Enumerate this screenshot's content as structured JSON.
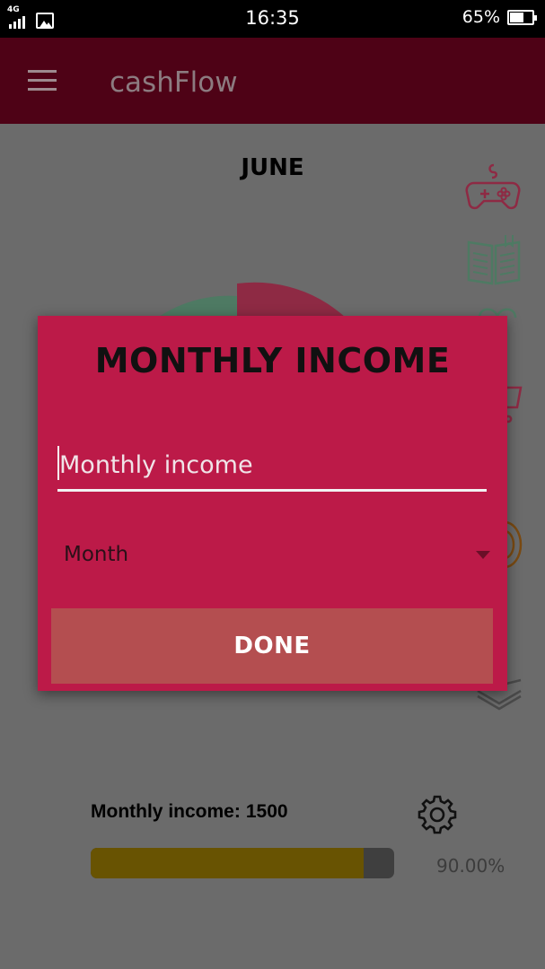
{
  "status_bar": {
    "network": "4G",
    "time": "16:35",
    "battery_percent": "65%",
    "battery_level": 0.65,
    "icons": [
      "signal-icon",
      "gallery-icon",
      "battery-icon"
    ]
  },
  "app_bar": {
    "title": "cashFlow",
    "menu_icon": "hamburger-menu-icon"
  },
  "main": {
    "month": "JUNE",
    "category_icons": [
      "gamepad-icon",
      "book-icon",
      "heart-icon",
      "shopping-cart-icon",
      "coin-icon",
      "stack-icon"
    ],
    "pie_colors": [
      "#8e2a44",
      "#4e7a63"
    ],
    "income_label": "Monthly income:",
    "income_value": "1500",
    "progress_fraction": 0.9,
    "progress_text": "90.00%",
    "settings_icon": "gear-icon"
  },
  "dialog": {
    "title": "MONTHLY INCOME",
    "income_input": {
      "value": "",
      "placeholder": "Monthly income"
    },
    "month_select": {
      "selected": "Month"
    },
    "done_label": "DONE"
  },
  "colors": {
    "app_bar": "#4e0216",
    "dialog": "#bc1a48",
    "done_button": "#b44e50",
    "progress_fill": "#685302",
    "scrim_background": "#6b6b6b"
  }
}
